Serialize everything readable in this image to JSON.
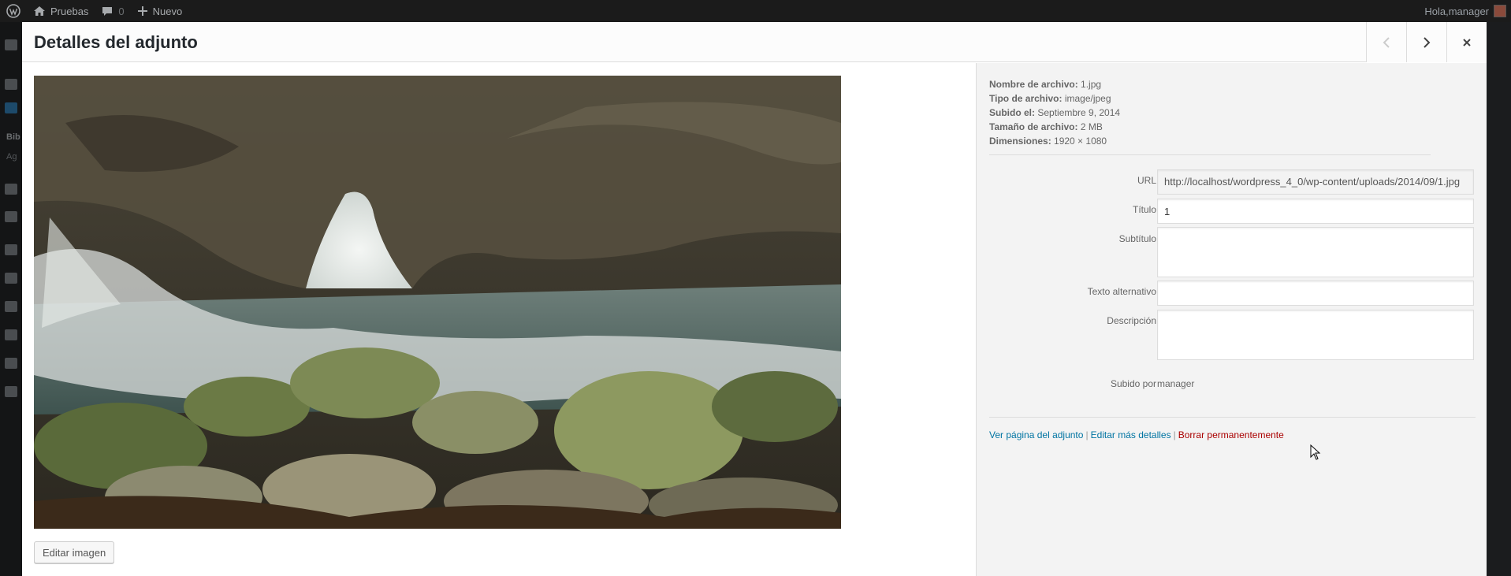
{
  "adminbar": {
    "site_name": "Pruebas",
    "comments_count": "0",
    "new_label": "Nuevo",
    "greeting": "Hola,manager"
  },
  "adminmenu": {
    "visible_text_1": "Bib",
    "visible_text_2": "Ag"
  },
  "modal": {
    "title": "Detalles del adjunto",
    "edit_image_label": "Editar imagen"
  },
  "file_info": {
    "filename_label": "Nombre de archivo:",
    "filename": "1.jpg",
    "filetype_label": "Tipo de archivo:",
    "filetype": "image/jpeg",
    "uploaded_label": "Subido el:",
    "uploaded": "Septiembre 9, 2014",
    "size_label": "Tamaño de archivo:",
    "size": "2 MB",
    "dimensions_label": "Dimensiones:",
    "dimensions": "1920 × 1080"
  },
  "fields": {
    "url_label": "URL",
    "url_value": "http://localhost/wordpress_4_0/wp-content/uploads/2014/09/1.jpg",
    "title_label": "Título",
    "title_value": "1",
    "caption_label": "Subtítulo",
    "caption_value": "",
    "alt_label": "Texto alternativo",
    "alt_value": "",
    "description_label": "Descripción",
    "description_value": "",
    "uploaded_by_label": "Subido por",
    "uploaded_by_value": "manager"
  },
  "actions": {
    "view_page": "Ver página del adjunto",
    "edit_more": "Editar más detalles",
    "delete": "Borrar permanentemente",
    "separator": "|"
  },
  "colors": {
    "link": "#0074a2",
    "delete": "#aa0000",
    "adminbar": "#1b1b1b"
  },
  "icons": {
    "wp_logo": "wordpress-logo-icon",
    "home": "home-icon",
    "comments": "comment-bubble-icon",
    "new": "plus-icon",
    "prev": "chevron-left-icon",
    "next": "chevron-right-icon",
    "close": "close-icon"
  }
}
